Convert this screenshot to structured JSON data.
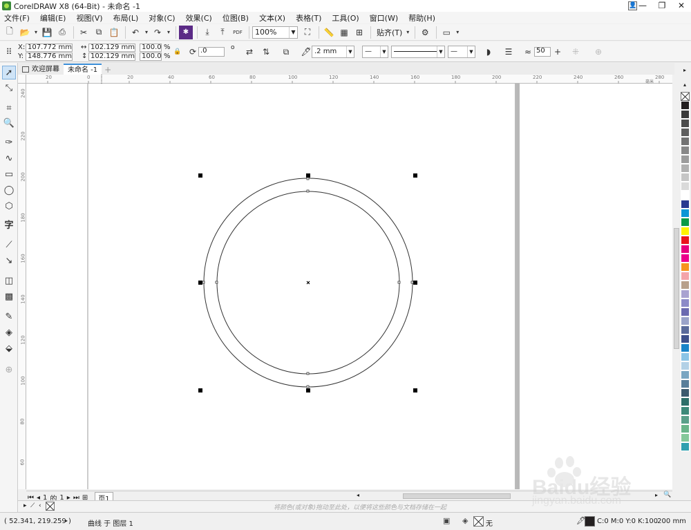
{
  "window": {
    "title": "CorelDRAW X8 (64-Bit) - 未命名 -1",
    "controls": [
      "—",
      "❐",
      "✕"
    ]
  },
  "menu": [
    "文件(F)",
    "编辑(E)",
    "视图(V)",
    "布局(L)",
    "对象(C)",
    "效果(C)",
    "位图(B)",
    "文本(X)",
    "表格(T)",
    "工具(O)",
    "窗口(W)",
    "帮助(H)"
  ],
  "toolbar": {
    "zoom": "100%",
    "snap_label": "贴齐(T)",
    "pdf_label": "PDF"
  },
  "property_bar": {
    "x_label": "X:",
    "x_value": "107.772 mm",
    "y_label": "Y:",
    "y_value": "148.776 mm",
    "width_value": "102.129 mm",
    "height_value": "102.129 mm",
    "scale_x": "100.0",
    "scale_y": "100.0",
    "percent": "%",
    "rotation": ".0",
    "degree": "o",
    "outline_width": ".2 mm",
    "smoothing": "50"
  },
  "tabs": [
    {
      "label": "欢迎屏幕",
      "active": false
    },
    {
      "label": "未命名 -1",
      "active": true
    }
  ],
  "ruler_top": [
    "20",
    "0",
    "20",
    "40",
    "60",
    "80",
    "100",
    "120",
    "140",
    "160",
    "180",
    "200",
    "220",
    "240",
    "260",
    "280"
  ],
  "ruler_unit": "毫米",
  "ruler_left": [
    "240",
    "220",
    "200",
    "180",
    "160",
    "140",
    "120",
    "100",
    "80",
    "60"
  ],
  "page_nav": {
    "current": "1",
    "of_label": "的",
    "total": "1",
    "page_tab": "页1"
  },
  "doc_palette_hint": "将颜色(或对象)拖动至此处，以便将这些颜色与文档存储在一起",
  "status": {
    "coords": "( 52.341, 219.259 )",
    "object_info": "曲线 于 图层 1",
    "fill_label": "无",
    "outline_color": "C:0 M:0 Y:0 K:100",
    "outline_width": ".200 mm"
  },
  "watermark": {
    "brand": "Baidu经验",
    "url": "jingyan.baidu.com"
  },
  "palette_colors": [
    "#231f20",
    "#3b3b3b",
    "#4c4c4c",
    "#5f5f5f",
    "#737373",
    "#888888",
    "#9c9c9c",
    "#b1b1b1",
    "#c6c6c6",
    "#dadada",
    "#ffffff",
    "#2a3990",
    "#0a96d6",
    "#0a9a48",
    "#fff200",
    "#e9141c",
    "#e6007e",
    "#ec008c",
    "#f7941d",
    "#f4a4a9",
    "#b8a08a",
    "#a9a2d0",
    "#8c8ac8",
    "#6b6ab0",
    "#9aa3c9",
    "#5a6a9a",
    "#3e4f8a",
    "#1a84c8",
    "#8bc4e6",
    "#b3d1e6",
    "#7aa6c2",
    "#5a7f9a",
    "#3d5a6e",
    "#2f6f6a",
    "#3e8a7a",
    "#5aa08a",
    "#6ab58a",
    "#85c89a",
    "#30a0b0"
  ]
}
